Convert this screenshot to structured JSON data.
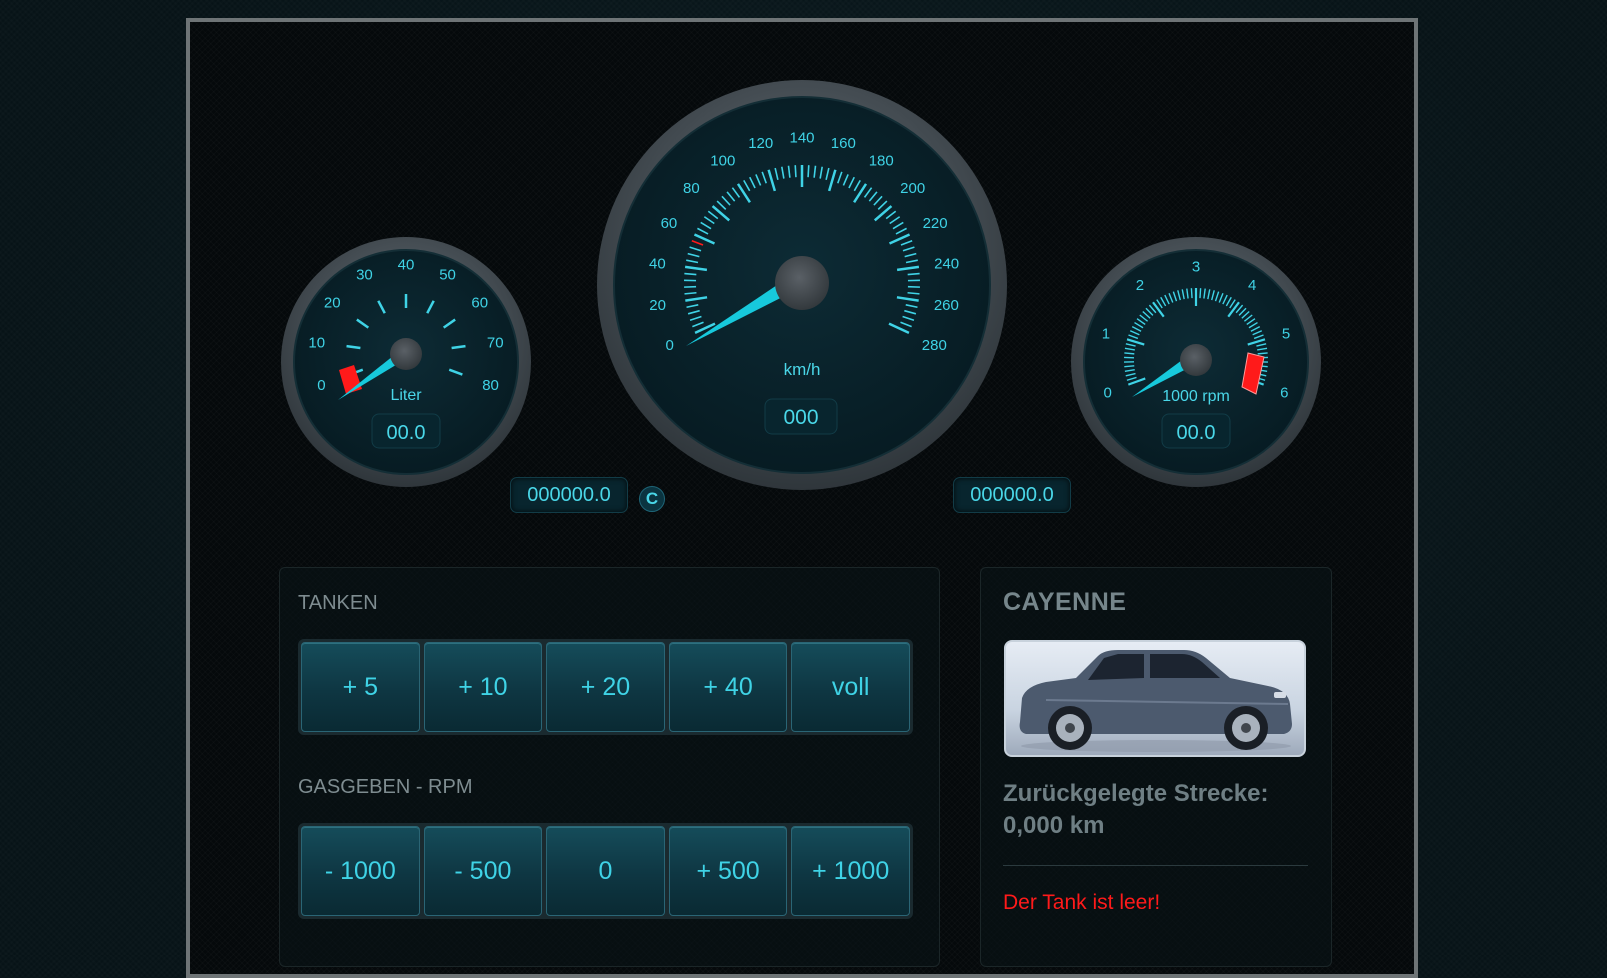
{
  "fuel_gauge": {
    "ticks": [
      "0",
      "10",
      "20",
      "30",
      "40",
      "50",
      "60",
      "70",
      "80"
    ],
    "unit": "Liter",
    "readout": "00.0"
  },
  "speed_gauge": {
    "ticks": [
      "0",
      "20",
      "40",
      "60",
      "80",
      "100",
      "120",
      "140",
      "160",
      "180",
      "200",
      "220",
      "240",
      "260",
      "280"
    ],
    "unit": "km/h",
    "readout": "000"
  },
  "rpm_gauge": {
    "ticks": [
      "0",
      "1",
      "2",
      "3",
      "4",
      "5",
      "6"
    ],
    "unit": "1000 rpm",
    "readout": "00.0"
  },
  "odometer": {
    "trip": "000000.0",
    "reset_label": "C",
    "total": "000000.0"
  },
  "controls": {
    "tanken_title": "TANKEN",
    "tanken_buttons": [
      "+ 5",
      "+ 10",
      "+ 20",
      "+ 40",
      "voll"
    ],
    "gas_title": "GASGEBEN - RPM",
    "gas_buttons": [
      "- 1000",
      "- 500",
      "0",
      "+ 500",
      "+ 1000"
    ]
  },
  "car": {
    "name": "CAYENNE",
    "distance_label": "Zurückgelegte Strecke:",
    "distance_value": "0,000 km",
    "warning": "Der Tank ist leer!"
  },
  "colors": {
    "accent": "#3fd3e6",
    "needle": "#17c9dc",
    "warning": "#ff1a1a"
  }
}
